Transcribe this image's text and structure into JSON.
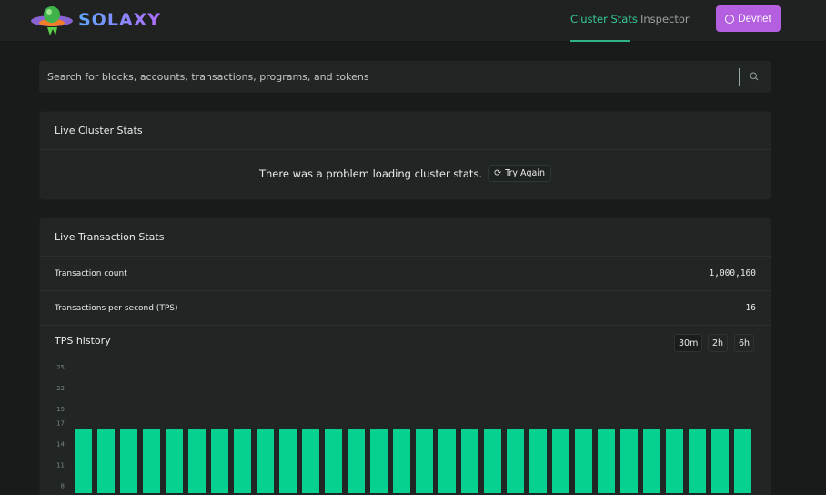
{
  "header": {
    "logo_text": "SOLAXY",
    "nav": [
      {
        "label": "Cluster Stats",
        "active": true
      },
      {
        "label": "Inspector",
        "active": false
      }
    ],
    "cluster_button": "Devnet",
    "accent": "#37c79a",
    "button_color": "#b45ee0"
  },
  "search": {
    "placeholder": "Search for blocks, accounts, transactions, programs, and tokens",
    "value": ""
  },
  "cluster_card": {
    "title": "Live Cluster Stats",
    "error": "There was a problem loading cluster stats.",
    "retry_label": "Try Again"
  },
  "tx_card": {
    "title": "Live Transaction Stats",
    "rows": [
      {
        "label": "Transaction count",
        "value": "1,000,160"
      },
      {
        "label": "Transactions per second (TPS)",
        "value": "16"
      }
    ],
    "history_title": "TPS history",
    "ranges": [
      {
        "label": "30m",
        "active": true
      },
      {
        "label": "2h",
        "active": false
      },
      {
        "label": "6h",
        "active": false
      }
    ]
  },
  "chart_data": {
    "type": "bar",
    "title": "TPS history",
    "yticks": [
      8,
      11,
      14,
      17,
      19,
      22,
      25
    ],
    "ylim_top": 25,
    "bar_color": "#07d190",
    "values": [
      16,
      16,
      16,
      16,
      16,
      16,
      16,
      16,
      16,
      16,
      16,
      16,
      16,
      16,
      16,
      16,
      16,
      16,
      16,
      16,
      16,
      16,
      16,
      16,
      16,
      16,
      16,
      16,
      16,
      16
    ]
  }
}
